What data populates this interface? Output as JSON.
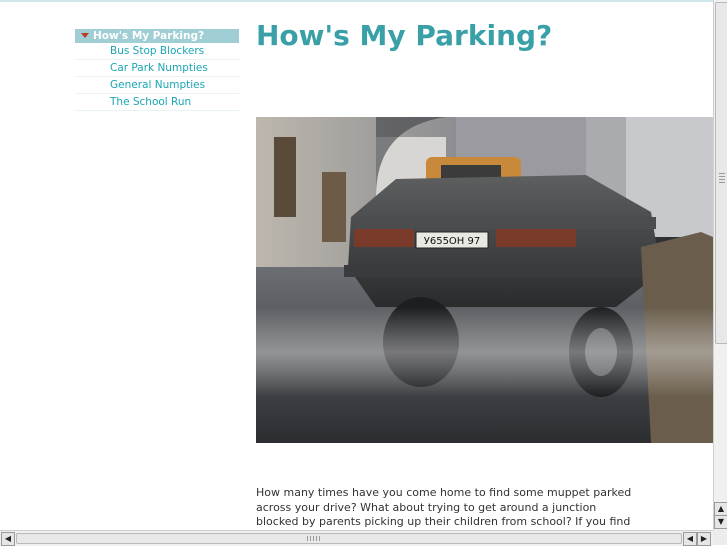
{
  "nav": {
    "active_label": "How's My Parking?",
    "items": [
      {
        "label": "Bus Stop Blockers"
      },
      {
        "label": "Car Park Numpties"
      },
      {
        "label": "General Numpties"
      },
      {
        "label": "The School Run"
      }
    ]
  },
  "main": {
    "title": "How's My Parking?",
    "plate_text": "У655ОН 97",
    "intro": "How many times have you come home to find some muppet parked across your drive? What about trying to get around a junction blocked by parents picking up their children from school? If you find your blood"
  },
  "colors": {
    "accent": "#3aa0a8",
    "nav_active_bg": "#9fcfd4",
    "link": "#1ba6b4"
  },
  "icons": {
    "nav_expanded": "triangle-down-icon",
    "scroll_up": "arrow-up-icon",
    "scroll_down": "arrow-down-icon",
    "scroll_left": "arrow-left-icon",
    "scroll_right": "arrow-right-icon"
  }
}
